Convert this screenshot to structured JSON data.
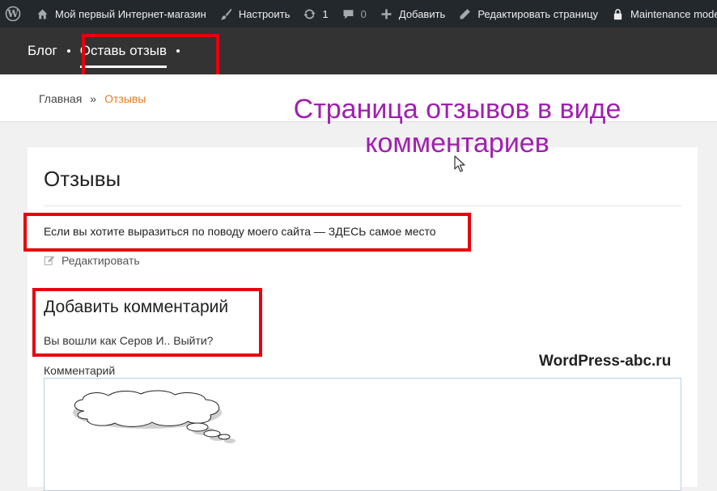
{
  "adminbar": {
    "site_name": "Мой первый Интернет-магазин",
    "customize": "Настроить",
    "updates_count": "1",
    "comments_count": "0",
    "add_new": "Добавить",
    "edit_page": "Редактировать страницу",
    "maintenance": "Maintenance mode"
  },
  "nav": {
    "items": [
      {
        "label": "Блог"
      },
      {
        "label": "Оставь отзыв",
        "active": true
      }
    ]
  },
  "breadcrumb": {
    "home": "Главная",
    "separator": "»",
    "current": "Отзывы"
  },
  "annotation": {
    "line1": "Страница отзывов в виде",
    "line2": "комментариев"
  },
  "page": {
    "title": "Отзывы",
    "intro": "Если вы хотите выразиться по поводу моего сайта — ЗДЕСЬ самое место",
    "edit_link": "Редактировать"
  },
  "comment_form": {
    "title": "Добавить комментарий",
    "logged_in": "Вы вошли как Серов И.. Выйти?",
    "label": "Комментарий",
    "value": ""
  },
  "watermark": "WordPress-abc.ru",
  "colors": {
    "adminbar_bg": "#23282d",
    "nav_bg": "#333333",
    "highlight": "#e8000b",
    "annotation": "#a020b0",
    "breadcrumb_current": "#e67e22"
  },
  "icons": [
    "wordpress-logo-icon",
    "brush-icon",
    "refresh-icon",
    "comment-bubble-icon",
    "plus-icon",
    "pencil-icon",
    "lock-icon",
    "edit-icon"
  ]
}
